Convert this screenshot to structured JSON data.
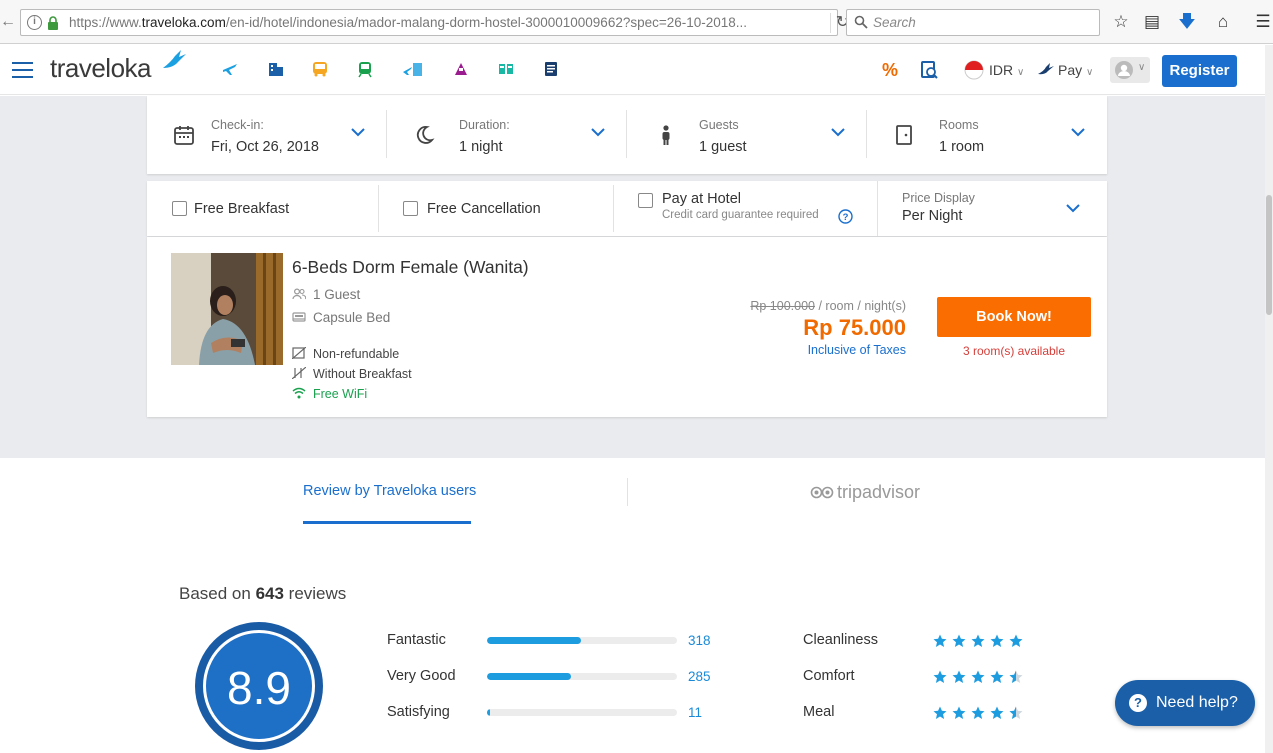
{
  "browser": {
    "url_prefix": "https://www.",
    "url_domain": "traveloka.com",
    "url_rest": "/en-id/hotel/indonesia/mador-malang-dorm-hostel-3000010009662?spec=26-10-2018...",
    "search_placeholder": "Search"
  },
  "header": {
    "logo": "traveloka",
    "currency": "IDR",
    "pay": "Pay",
    "register": "Register"
  },
  "search_bar": {
    "checkin": {
      "label": "Check-in:",
      "value": "Fri, Oct 26, 2018"
    },
    "duration": {
      "label": "Duration:",
      "value": "1 night"
    },
    "guests": {
      "label": "Guests",
      "value": "1 guest"
    },
    "rooms": {
      "label": "Rooms",
      "value": "1 room"
    }
  },
  "filters": {
    "free_breakfast": "Free Breakfast",
    "free_cancellation": "Free Cancellation",
    "pay_at_hotel": "Pay at Hotel",
    "pay_at_hotel_note": "Credit card guarantee required",
    "price_display_label": "Price Display",
    "price_display_value": "Per Night"
  },
  "room": {
    "title": "6-Beds Dorm Female (Wanita)",
    "guests": "1 Guest",
    "bed": "Capsule Bed",
    "refund": "Non-refundable",
    "breakfast": "Without Breakfast",
    "wifi": "Free WiFi",
    "old_price": "Rp 100.000",
    "old_price_unit": " / room / night(s)",
    "price": "Rp 75.000",
    "inclusive": "Inclusive of Taxes",
    "book": "Book Now!",
    "available": "3 room(s) available"
  },
  "reviews": {
    "tab_traveloka": "Review by Traveloka users",
    "tab_tripadvisor": "tripadvisor",
    "based_prefix": "Based on ",
    "based_count": "643",
    "based_suffix": " reviews",
    "score": "8.9",
    "breakdown": [
      {
        "label": "Fantastic",
        "count": "318",
        "fraction": 0.495
      },
      {
        "label": "Very Good",
        "count": "285",
        "fraction": 0.443
      },
      {
        "label": "Satisfying",
        "count": "11",
        "fraction": 0.017
      }
    ],
    "categories": [
      {
        "label": "Cleanliness",
        "stars": 5
      },
      {
        "label": "Comfort",
        "stars": 4.5
      },
      {
        "label": "Meal",
        "stars": 4.5
      }
    ]
  },
  "help": "Need help?",
  "colors": {
    "accent": "#1a6fce",
    "orange": "#f96d01",
    "star": "#1e9ce0"
  }
}
